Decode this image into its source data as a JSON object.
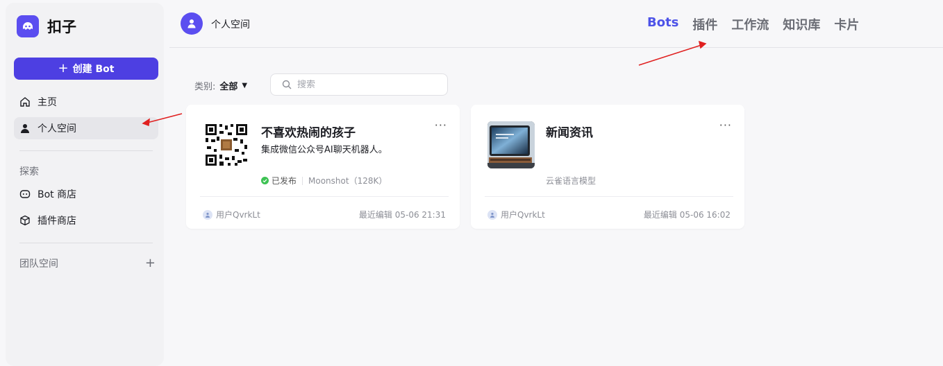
{
  "app": {
    "name": "扣子"
  },
  "sidebar": {
    "create_label": "创建 Bot",
    "items": [
      {
        "label": "主页",
        "icon": "home-icon"
      },
      {
        "label": "个人空间",
        "icon": "user-icon"
      }
    ],
    "explore_label": "探索",
    "explore_items": [
      {
        "label": "Bot 商店",
        "icon": "bot-icon"
      },
      {
        "label": "插件商店",
        "icon": "cube-icon"
      }
    ],
    "team_label": "团队空间"
  },
  "header": {
    "space_name": "个人空间",
    "tabs": [
      "Bots",
      "插件",
      "工作流",
      "知识库",
      "卡片"
    ]
  },
  "filter": {
    "label": "类别:",
    "value": "全部",
    "search_placeholder": "搜索"
  },
  "cards": [
    {
      "title": "不喜欢热闹的孩子",
      "description": "集成微信公众号AI聊天机器人。",
      "status": "已发布",
      "model": "Moonshot（128K）",
      "owner": "用户QvrkLt",
      "edited": "最近编辑 05-06 21:31"
    },
    {
      "title": "新闻资讯",
      "description": "",
      "status": "",
      "model": "云雀语言模型",
      "owner": "用户QvrkLt",
      "edited": "最近编辑 05-06 16:02"
    }
  ],
  "colors": {
    "accent": "#4d3fe2",
    "tab_active": "#4d53e8",
    "annotation": "#e02020"
  }
}
